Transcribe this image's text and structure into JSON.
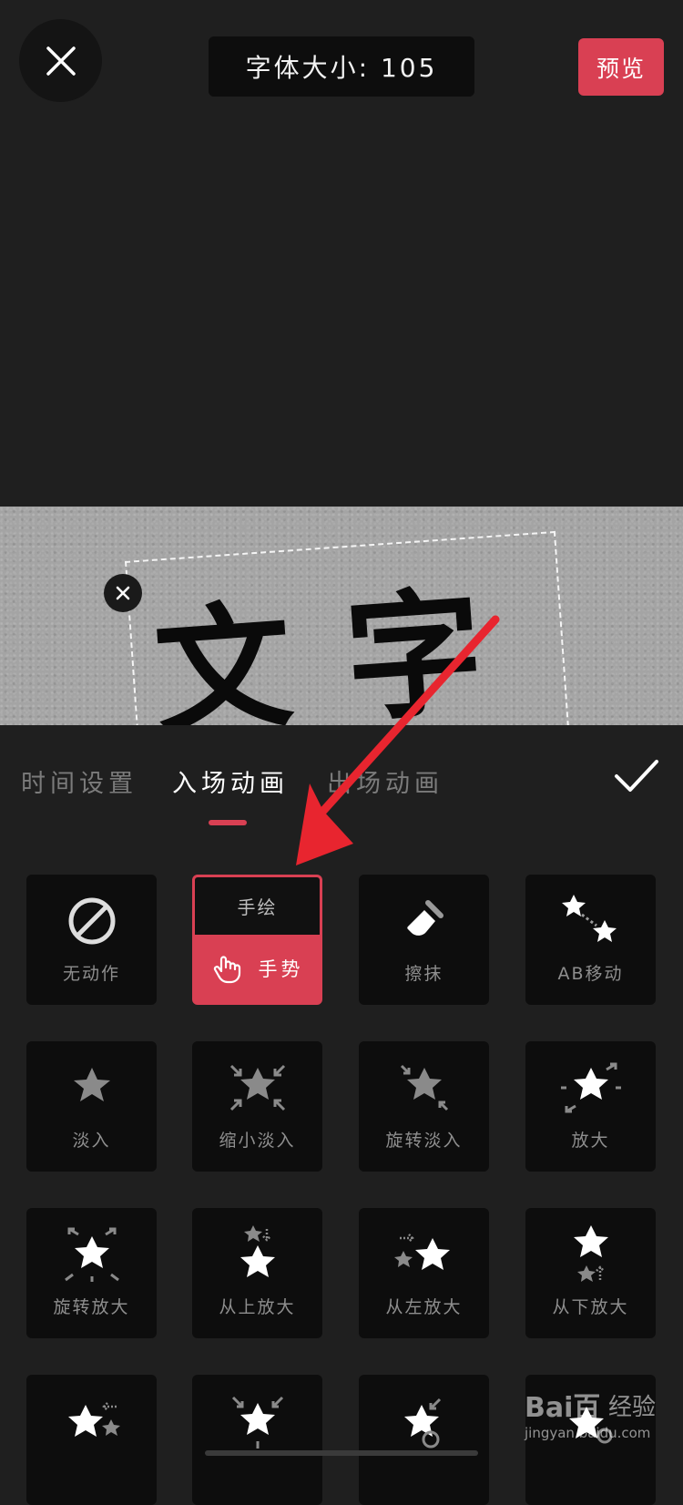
{
  "header": {
    "font_size_label": "字体大小: 105",
    "preview_label": "预览"
  },
  "canvas": {
    "text": "文字"
  },
  "tabs": [
    {
      "label": "时间设置",
      "active": false
    },
    {
      "label": "入场动画",
      "active": true
    },
    {
      "label": "出场动画",
      "active": false
    }
  ],
  "animations": [
    {
      "label": "无动作",
      "icon": "no-action-icon"
    },
    {
      "label": "手势",
      "icon": "hand-gesture-icon",
      "top_label": "手绘",
      "selected": true
    },
    {
      "label": "擦抹",
      "icon": "eraser-icon"
    },
    {
      "label": "AB移动",
      "icon": "ab-move-icon"
    },
    {
      "label": "淡入",
      "icon": "fade-in-icon"
    },
    {
      "label": "缩小淡入",
      "icon": "shrink-fade-in-icon"
    },
    {
      "label": "旋转淡入",
      "icon": "rotate-fade-in-icon"
    },
    {
      "label": "放大",
      "icon": "zoom-in-icon"
    },
    {
      "label": "旋转放大",
      "icon": "rotate-zoom-icon"
    },
    {
      "label": "从上放大",
      "icon": "zoom-from-top-icon"
    },
    {
      "label": "从左放大",
      "icon": "zoom-from-left-icon"
    },
    {
      "label": "从下放大",
      "icon": "zoom-from-bottom-icon"
    },
    {
      "label": "",
      "icon": "zoom-from-right-icon"
    },
    {
      "label": "",
      "icon": "shrink-zoom-icon"
    },
    {
      "label": "",
      "icon": "rotate-star-icon"
    },
    {
      "label": "",
      "icon": "star-dot-icon"
    }
  ],
  "watermark": {
    "logo": "Bai百",
    "tag": "经验",
    "url": "jingyan.baidu.com"
  },
  "colors": {
    "accent": "#d94053",
    "background": "#1f1f1f",
    "tile": "#0d0d0d",
    "arrow": "#e8252f"
  }
}
